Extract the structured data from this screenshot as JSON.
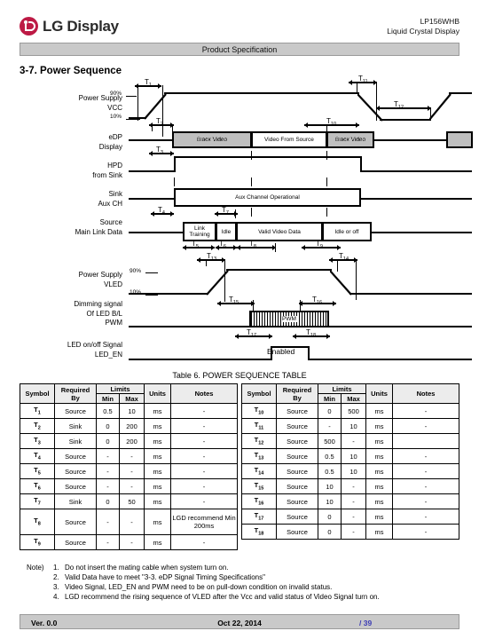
{
  "header": {
    "brand": "LG Display",
    "model": "LP156WHB",
    "product_type": "Liquid Crystal Display",
    "spec_bar": "Product Specification"
  },
  "section": {
    "title": "3-7. Power Sequence"
  },
  "diagram": {
    "rows": [
      {
        "id": "vcc",
        "label_line1": "Power Supply",
        "label_line2": "VCC"
      },
      {
        "id": "edp",
        "label_line1": "eDP",
        "label_line2": "Display"
      },
      {
        "id": "hpd",
        "label_line1": "HPD",
        "label_line2": "from Sink"
      },
      {
        "id": "aux",
        "label_line1": "Sink",
        "label_line2": "Aux CH"
      },
      {
        "id": "mld",
        "label_line1": "Source",
        "label_line2": "Main Link Data"
      },
      {
        "id": "vled",
        "label_line1": "Power Supply",
        "label_line2": "VLED"
      },
      {
        "id": "pwm",
        "label_line1": "Dimming signal",
        "label_line2": "Of LED B/L",
        "label_line3": "PWM"
      },
      {
        "id": "leden",
        "label_line1": "LED on/off Signal",
        "label_line2": "LED_EN"
      }
    ],
    "levels": {
      "high": "90%",
      "low": "10%"
    },
    "blocks": {
      "black_video_1": "Black Video",
      "video_from_source": "Video From Source",
      "black_video_2": "Black Video",
      "aux_channel": "Aux Channel Operational",
      "link_training": "Link Training",
      "idle": "Idle",
      "valid_video_data": "Valid Video Data",
      "idle_or_off": "Idle or off",
      "pwm": "PWM",
      "enabled": "Enabled"
    },
    "markers": [
      "T1",
      "T2",
      "T3",
      "T4",
      "T5",
      "T6",
      "T7",
      "T8",
      "T9",
      "T10",
      "T11",
      "T12",
      "T13",
      "T14",
      "T15",
      "T16",
      "T17",
      "T18"
    ]
  },
  "table": {
    "caption": "Table 6. POWER SEQUENCE TABLE",
    "headers": {
      "symbol": "Symbol",
      "required_by_line1": "Required",
      "required_by_line2": "By",
      "limits": "Limits",
      "min": "Min",
      "max": "Max",
      "units": "Units",
      "notes": "Notes"
    },
    "left_rows": [
      {
        "symbol": "T",
        "sub": "1",
        "by": "Source",
        "min": "0.5",
        "max": "10",
        "units": "ms",
        "notes": "-"
      },
      {
        "symbol": "T",
        "sub": "2",
        "by": "Sink",
        "min": "0",
        "max": "200",
        "units": "ms",
        "notes": "-"
      },
      {
        "symbol": "T",
        "sub": "3",
        "by": "Sink",
        "min": "0",
        "max": "200",
        "units": "ms",
        "notes": "-"
      },
      {
        "symbol": "T",
        "sub": "4",
        "by": "Source",
        "min": "-",
        "max": "-",
        "units": "ms",
        "notes": "-"
      },
      {
        "symbol": "T",
        "sub": "5",
        "by": "Source",
        "min": "-",
        "max": "-",
        "units": "ms",
        "notes": "-"
      },
      {
        "symbol": "T",
        "sub": "6",
        "by": "Source",
        "min": "-",
        "max": "-",
        "units": "ms",
        "notes": "-"
      },
      {
        "symbol": "T",
        "sub": "7",
        "by": "Sink",
        "min": "0",
        "max": "50",
        "units": "ms",
        "notes": "-"
      },
      {
        "symbol": "T",
        "sub": "8",
        "by": "Source",
        "min": "-",
        "max": "-",
        "units": "ms",
        "notes": "LGD recommend Min 200ms"
      },
      {
        "symbol": "T",
        "sub": "9",
        "by": "Source",
        "min": "-",
        "max": "-",
        "units": "ms",
        "notes": "-"
      }
    ],
    "right_rows": [
      {
        "symbol": "T",
        "sub": "10",
        "by": "Source",
        "min": "0",
        "max": "500",
        "units": "ms",
        "notes": "-"
      },
      {
        "symbol": "T",
        "sub": "11",
        "by": "Source",
        "min": "-",
        "max": "10",
        "units": "ms",
        "notes": "-"
      },
      {
        "symbol": "T",
        "sub": "12",
        "by": "Source",
        "min": "500",
        "max": "-",
        "units": "ms",
        "notes": ""
      },
      {
        "symbol": "T",
        "sub": "13",
        "by": "Source",
        "min": "0.5",
        "max": "10",
        "units": "ms",
        "notes": "-"
      },
      {
        "symbol": "T",
        "sub": "14",
        "by": "Source",
        "min": "0.5",
        "max": "10",
        "units": "ms",
        "notes": "-"
      },
      {
        "symbol": "T",
        "sub": "15",
        "by": "Source",
        "min": "10",
        "max": "-",
        "units": "ms",
        "notes": "-"
      },
      {
        "symbol": "T",
        "sub": "16",
        "by": "Source",
        "min": "10",
        "max": "-",
        "units": "ms",
        "notes": "-"
      },
      {
        "symbol": "T",
        "sub": "17",
        "by": "Source",
        "min": "0",
        "max": "-",
        "units": "ms",
        "notes": "-"
      },
      {
        "symbol": "T",
        "sub": "18",
        "by": "Source",
        "min": "0",
        "max": "-",
        "units": "ms",
        "notes": "-"
      }
    ]
  },
  "notes": {
    "label": "Note)",
    "items": [
      {
        "num": "1.",
        "text": "Do not insert the mating cable when system turn on."
      },
      {
        "num": "2.",
        "text": "Valid Data have to meet  \"3-3. eDP Signal Timing Specifications\""
      },
      {
        "num": "3.",
        "text": "Video Signal, LED_EN and PWM need to be on pull-down condition on invalid status."
      },
      {
        "num": "4.",
        "text": "LGD recommend the rising sequence of VLED after the Vcc and valid status of Video Signal turn on."
      }
    ]
  },
  "footer": {
    "version": "Ver. 0.0",
    "date": "Oct 22, 2014",
    "page": "/ 39"
  }
}
